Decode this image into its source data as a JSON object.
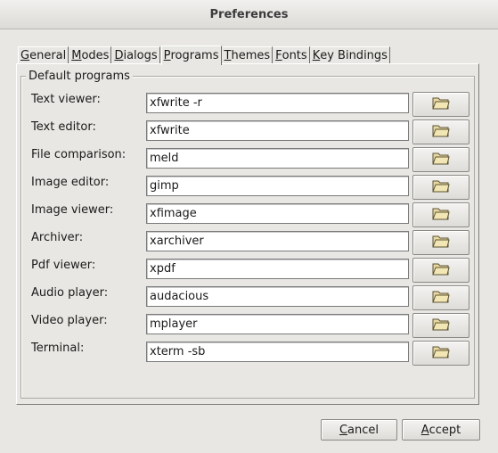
{
  "window": {
    "title": "Preferences"
  },
  "tabs": [
    {
      "label": "General",
      "mnemonic": "G"
    },
    {
      "label": "Modes",
      "mnemonic": "M"
    },
    {
      "label": "Dialogs",
      "mnemonic": "D"
    },
    {
      "label": "Programs",
      "mnemonic": "P"
    },
    {
      "label": "Themes",
      "mnemonic": "T"
    },
    {
      "label": "Fonts",
      "mnemonic": "F"
    },
    {
      "label": "Key Bindings",
      "mnemonic": "K"
    }
  ],
  "active_tab": "Programs",
  "group": {
    "legend": "Default programs"
  },
  "programs": [
    {
      "label": "Text viewer:",
      "value": "xfwrite -r"
    },
    {
      "label": "Text editor:",
      "value": "xfwrite"
    },
    {
      "label": "File comparison:",
      "value": "meld"
    },
    {
      "label": "Image editor:",
      "value": "gimp"
    },
    {
      "label": "Image viewer:",
      "value": "xfimage"
    },
    {
      "label": "Archiver:",
      "value": "xarchiver"
    },
    {
      "label": "Pdf viewer:",
      "value": "xpdf"
    },
    {
      "label": "Audio player:",
      "value": "audacious"
    },
    {
      "label": "Video player:",
      "value": "mplayer"
    },
    {
      "label": "Terminal:",
      "value": "xterm -sb"
    }
  ],
  "buttons": {
    "cancel": {
      "first": "C",
      "rest": "ancel"
    },
    "accept": {
      "first": "A",
      "rest": "ccept"
    }
  }
}
